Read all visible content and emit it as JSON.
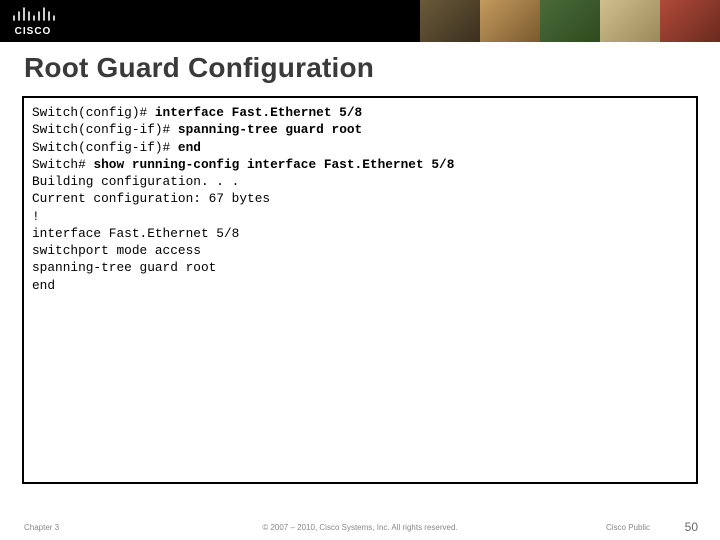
{
  "header": {
    "logo_name": "cisco-logo"
  },
  "title": "Root Guard Configuration",
  "code": {
    "lines": [
      {
        "prompt": "Switch(config)# ",
        "cmd": "interface Fast.Ethernet 5/8"
      },
      {
        "prompt": "Switch(config-if)# ",
        "cmd": "spanning-tree guard root"
      },
      {
        "prompt": "Switch(config-if)# ",
        "cmd": "end"
      },
      {
        "prompt": "Switch# ",
        "cmd": "show running-config interface Fast.Ethernet 5/8"
      },
      {
        "plain": "Building configuration. . ."
      },
      {
        "plain": "Current configuration: 67 bytes"
      },
      {
        "plain": "!"
      },
      {
        "plain": "interface Fast.Ethernet 5/8"
      },
      {
        "plain": "switchport mode access"
      },
      {
        "plain": "spanning-tree guard root"
      },
      {
        "plain": "end"
      }
    ]
  },
  "footer": {
    "chapter": "Chapter 3",
    "copyright": "© 2007 – 2010, Cisco Systems, Inc. All rights reserved.",
    "classification": "Cisco Public",
    "page": "50"
  }
}
